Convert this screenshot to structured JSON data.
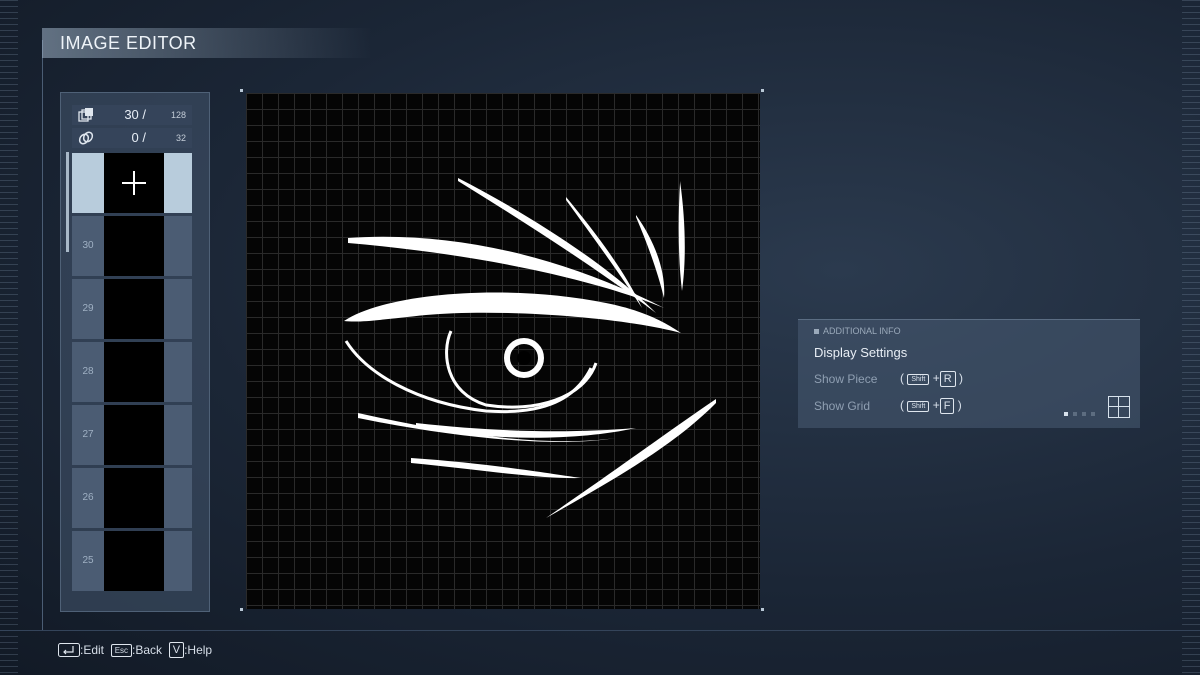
{
  "header": {
    "title": "IMAGE EDITOR"
  },
  "counters": [
    {
      "icon": "layers-icon",
      "count": "30 /",
      "max": "128"
    },
    {
      "icon": "link-icon",
      "count": "0 /",
      "max": "32"
    }
  ],
  "layers": [
    {
      "num": ""
    },
    {
      "num": "30"
    },
    {
      "num": "29"
    },
    {
      "num": "28"
    },
    {
      "num": "27"
    },
    {
      "num": "26"
    },
    {
      "num": "25"
    }
  ],
  "info": {
    "header": "ADDITIONAL INFO",
    "title": "Display Settings",
    "show_piece": {
      "label": "Show Piece",
      "mod": "Shift",
      "key": "R"
    },
    "show_grid": {
      "label": "Show Grid",
      "mod": "Shift",
      "key": "F"
    },
    "grid_level": {
      "active": 1,
      "total": 4
    }
  },
  "footer": {
    "edit_label": ":Edit",
    "esc_key": "Esc",
    "back_label": ":Back",
    "help_key": "V",
    "help_label": ":Help"
  }
}
